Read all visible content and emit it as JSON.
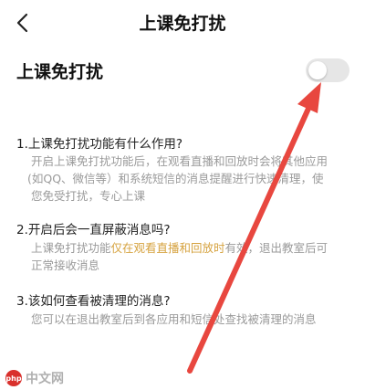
{
  "header": {
    "back_icon": "chevron-left-icon",
    "title": "上课免打扰"
  },
  "setting": {
    "label": "上课免打扰",
    "toggle_on": false
  },
  "faq": [
    {
      "question": "1.上课免打扰功能有什么作用?",
      "answer_lines": [
        "开启上课免打扰功能后，在观看直播和回放时会将其他应用",
        "(如QQ、微信等）和系统短信的消息提醒进行快速清理，使",
        "您免受打扰，专心上课"
      ]
    },
    {
      "question": "2.开启后会一直屏蔽消息吗?",
      "answer_pre": "上课免打扰功能",
      "answer_highlight": "仅在观看直播和回放时",
      "answer_post": "有效，退出教室后可",
      "answer_line2": "正常接收消息"
    },
    {
      "question": "3.该如何查看被清理的消息?",
      "answer_lines": [
        "您可以在退出教室后到各应用和短信处查找被清理的消息"
      ]
    }
  ],
  "colors": {
    "highlight": "#d6a340",
    "arrow": "#e8473f",
    "toggle_off": "#e6e6e6"
  },
  "watermark": {
    "logo_text": "php",
    "text": "中文网"
  }
}
